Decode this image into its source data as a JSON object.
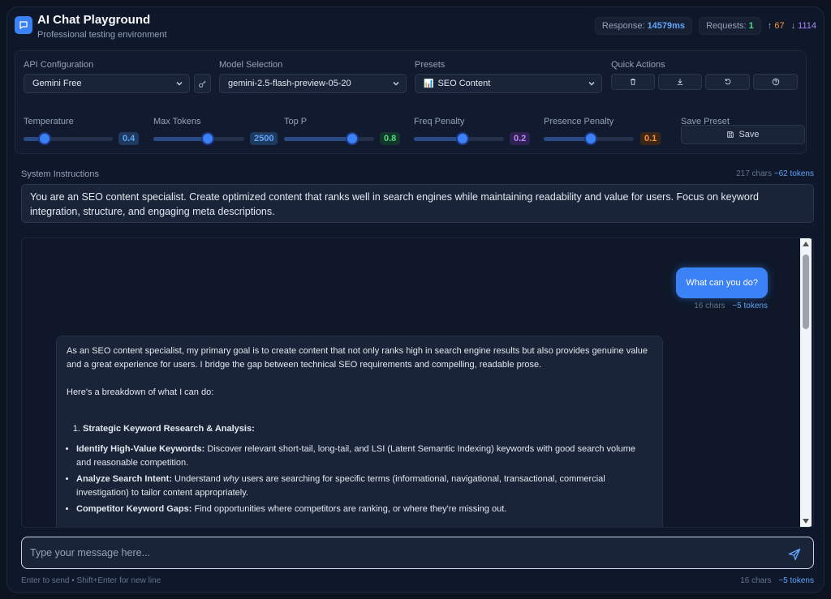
{
  "header": {
    "title": "AI Chat Playground",
    "subtitle": "Professional testing environment",
    "response_label": "Response:",
    "response_value": "14579ms",
    "requests_label": "Requests:",
    "requests_value": "1",
    "tokens_up": "67",
    "tokens_down": "1114"
  },
  "config": {
    "api_label": "API Configuration",
    "api_value": "Gemini Free",
    "model_label": "Model Selection",
    "model_value": "gemini-2.5-flash-preview-05-20",
    "presets_label": "Presets",
    "presets_icon": "📊",
    "presets_value": "SEO Content",
    "quick_actions_label": "Quick Actions",
    "sliders": {
      "temperature": {
        "label": "Temperature",
        "value": "0.4",
        "fraction": 0.24
      },
      "max_tokens": {
        "label": "Max Tokens",
        "value": "2500",
        "fraction": 0.6
      },
      "top_p": {
        "label": "Top P",
        "value": "0.8",
        "fraction": 0.76
      },
      "freq_penalty": {
        "label": "Freq Penalty",
        "value": "0.2",
        "fraction": 0.54
      },
      "presence_penalty": {
        "label": "Presence Penalty",
        "value": "0.1",
        "fraction": 0.52
      }
    },
    "save_preset_label": "Save Preset",
    "save_label": "Save"
  },
  "system": {
    "label": "System Instructions",
    "chars": "217 chars",
    "tokens": "~62 tokens",
    "text": "You are an SEO content specialist. Create optimized content that ranks well in search engines while maintaining readability and value for users. Focus on keyword integration, structure, and engaging meta descriptions."
  },
  "chat": {
    "user_message": "What can you do?",
    "user_chars": "16 chars",
    "user_tokens": "~5 tokens",
    "bot_intro": "As an SEO content specialist, my primary goal is to create content that not only ranks high in search engine results but also provides genuine value and a great experience for users. I bridge the gap between technical SEO requirements and compelling, readable prose.",
    "bot_breakdown": "Here's a breakdown of what I can do:",
    "item1_title": "Strategic Keyword Research & Analysis:",
    "b1_title": "Identify High-Value Keywords:",
    "b1_text": " Discover relevant short-tail, long-tail, and LSI (Latent Semantic Indexing) keywords with good search volume and reasonable competition.",
    "b2_title": "Analyze Search Intent:",
    "b2_pre": " Understand ",
    "b2_em": "why",
    "b2_text": " users are searching for specific terms (informational, navigational, transactional, commercial investigation) to tailor content appropriately.",
    "b3_title": "Competitor Keyword Gaps:",
    "b3_text": " Find opportunities where competitors are ranking, or where they're missing out."
  },
  "input": {
    "placeholder": "Type your message here...",
    "hint": "Enter to send • Shift+Enter for new line",
    "chars": "16 chars",
    "tokens": "~5 tokens"
  },
  "colors": {
    "accent": "#3b82f6",
    "temperature_badge": "#60a5fa",
    "max_tokens_badge": "#60a5fa",
    "top_p_badge": "#4ade80",
    "freq_badge": "#c084fc",
    "presence_badge": "#fb923c"
  }
}
